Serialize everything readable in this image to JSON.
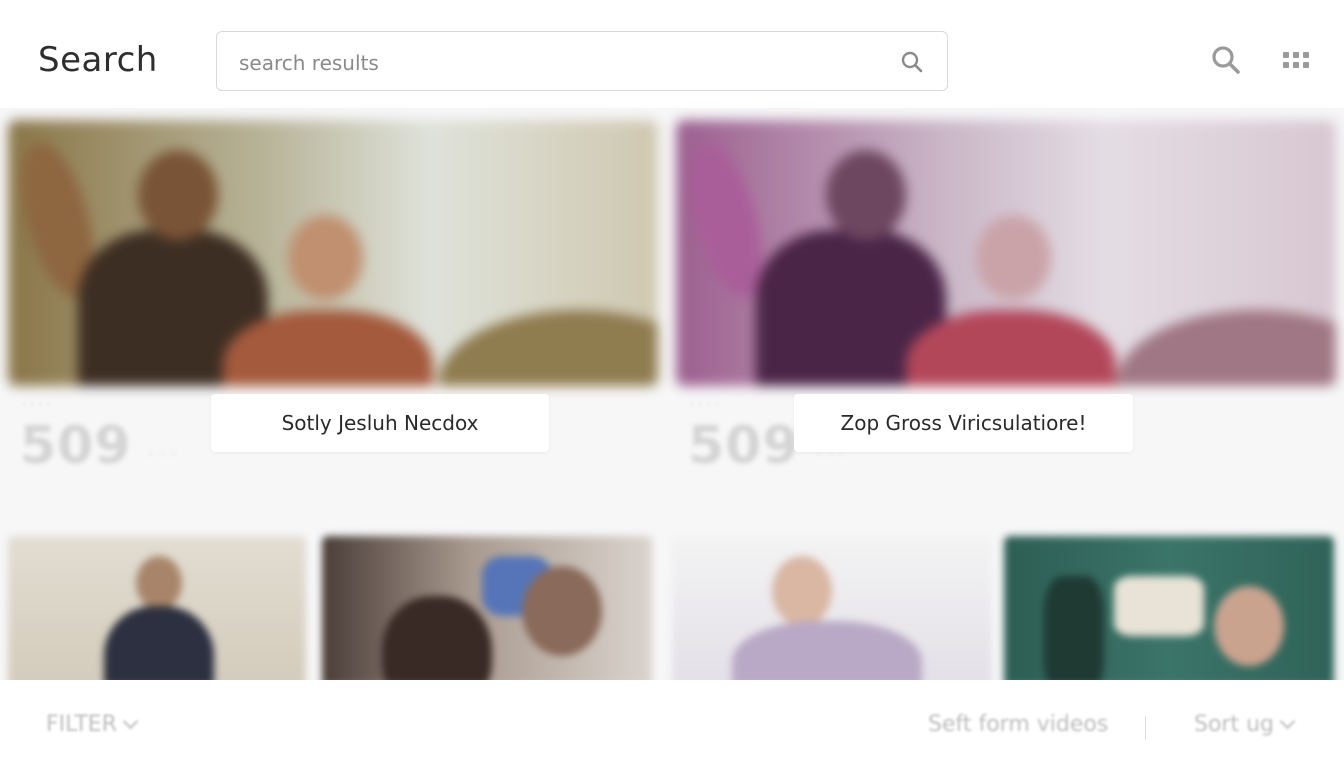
{
  "header": {
    "title": "Search",
    "search_placeholder": "search results",
    "search_value": ""
  },
  "results": {
    "featured": [
      {
        "label": "Sotly Jesluh Necdox",
        "count": "509"
      },
      {
        "label": "Zop Gross Viricsulatiore!",
        "count": "509"
      }
    ]
  },
  "footer": {
    "filter_label": "FILTER",
    "sort_text": "Seft form videos",
    "sort_label": "Sort ug"
  },
  "icons": {
    "search": "search-icon",
    "apps": "apps-grid-icon",
    "chevron": "chevron-down-icon"
  }
}
